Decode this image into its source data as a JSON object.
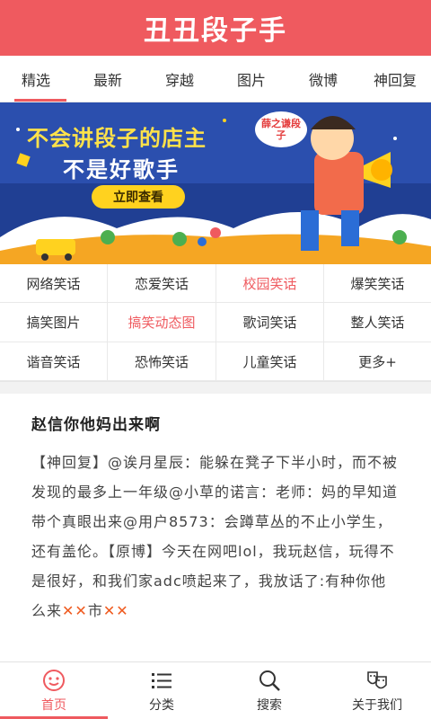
{
  "app": {
    "title": "丑丑段子手",
    "accent_color": "#ef5a5f"
  },
  "tabs": [
    {
      "label": "精选",
      "active": true
    },
    {
      "label": "最新"
    },
    {
      "label": "穿越"
    },
    {
      "label": "图片"
    },
    {
      "label": "微博"
    },
    {
      "label": "神回复"
    }
  ],
  "banner": {
    "line1": "不会讲段子的店主",
    "line2": "不是好歌手",
    "button_label": "立即查看",
    "bubble": "薛之谦段子"
  },
  "categories": [
    {
      "label": "网络笑话"
    },
    {
      "label": "恋爱笑话"
    },
    {
      "label": "校园笑话",
      "highlight": true
    },
    {
      "label": "爆笑笑话"
    },
    {
      "label": "搞笑图片"
    },
    {
      "label": "搞笑动态图",
      "highlight": true
    },
    {
      "label": "歌词笑话"
    },
    {
      "label": "整人笑话"
    },
    {
      "label": "谐音笑话"
    },
    {
      "label": "恐怖笑话"
    },
    {
      "label": "儿童笑话"
    },
    {
      "label": "更多+"
    }
  ],
  "article": {
    "title": "赵信你他妈出来啊",
    "body": "【神回复】@诶月星辰：能躲在凳子下半小时，而不被发现的最多上一年级@小草的诺言：老师：妈的早知道带个真眼出来@用户8573：会蹲草丛的不止小学生，还有盖伦。【原博】今天在网吧lol，我玩赵信，玩得不是很好，和我们家adc喷起来了，我放话了:有种你他么来",
    "x1": "✕✕",
    "mid": "市",
    "x2": "✕✕"
  },
  "bottom_nav": [
    {
      "label": "首页",
      "icon": "home-face-icon",
      "active": true
    },
    {
      "label": "分类",
      "icon": "list-icon"
    },
    {
      "label": "搜索",
      "icon": "search-icon"
    },
    {
      "label": "关于我们",
      "icon": "masks-icon"
    }
  ]
}
